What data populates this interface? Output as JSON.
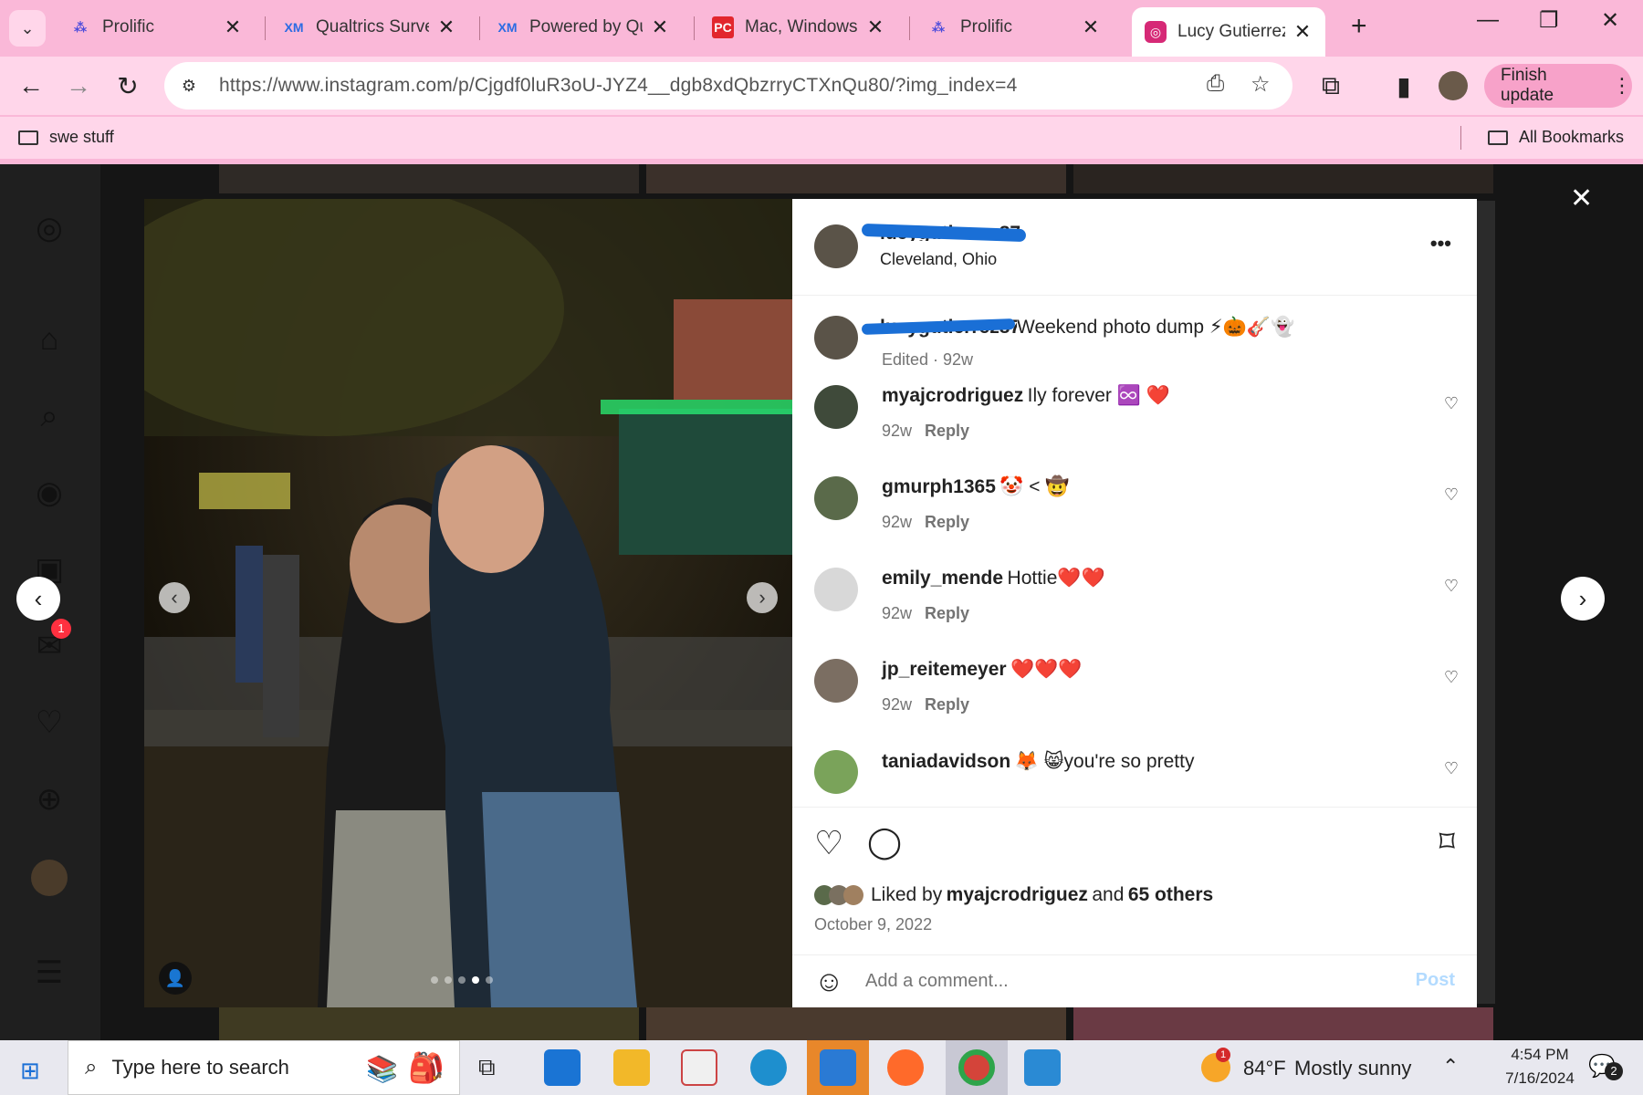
{
  "browser": {
    "tabs": [
      {
        "title": "Prolific",
        "icon": "prolific-icon",
        "color": "#4a4adb"
      },
      {
        "title": "Qualtrics Survey",
        "icon": "xm-icon",
        "color": "#2b6be3"
      },
      {
        "title": "Powered by Qua",
        "icon": "xm-icon",
        "color": "#2b6be3"
      },
      {
        "title": "Mac, Windows, C",
        "icon": "pc-icon",
        "color": "#e2262d"
      },
      {
        "title": "Prolific",
        "icon": "prolific-icon",
        "color": "#4a4adb"
      },
      {
        "title": "Lucy Gutierrez (",
        "icon": "instagram-icon",
        "color": "#d62976",
        "active": true
      }
    ],
    "url": "https://www.instagram.com/p/Cjgdf0luR3oU-JYZ4__dgb8xdQbzrryCTXnQu80/?img_index=4",
    "finish_update": "Finish update",
    "bookmarks": {
      "left": "swe stuff",
      "right": "All Bookmarks"
    }
  },
  "post": {
    "username_redacted": "lucygutierrez87",
    "location": "Cleveland, Ohio",
    "caption_user_redacted": "lucygutierrez87",
    "caption": "Weekend photo dump ⚡🎃🎸👻",
    "caption_meta": "Edited · 92w",
    "comments": [
      {
        "user": "myajcrodriguez",
        "text": "Ily forever ♾️ ❤️",
        "age": "92w",
        "reply": "Reply",
        "avatar_color": "#3f4a3a"
      },
      {
        "user": "gmurph1365",
        "text": "🤡 < 🤠",
        "age": "92w",
        "reply": "Reply",
        "avatar_color": "#5a6a4a"
      },
      {
        "user": "emily_mende",
        "text": "Hottie❤️❤️",
        "age": "92w",
        "reply": "Reply",
        "avatar_color": "#d8d8d8"
      },
      {
        "user": "jp_reitemeyer",
        "text": "❤️❤️❤️",
        "age": "92w",
        "reply": "Reply",
        "avatar_color": "#7b6e62"
      },
      {
        "user": "taniadavidson",
        "text": "🦊 😸you're so pretty",
        "age": "",
        "reply": "",
        "avatar_color": "#7aa35a"
      }
    ],
    "liked_by_prefix": "Liked by",
    "liked_by_user": "myajcrodriguez",
    "liked_by_and": "and",
    "liked_by_others": "65 others",
    "date": "October 9, 2022",
    "comment_placeholder": "Add a comment...",
    "post_button": "Post",
    "carousel": {
      "count": 5,
      "current": 4
    }
  },
  "taskbar": {
    "search_placeholder": "Type here to search",
    "weather_temp": "84°F",
    "weather_text": "Mostly sunny",
    "time": "4:54 PM",
    "date": "7/16/2024",
    "notifications": "2",
    "weather_badge": "1"
  },
  "sidebar": {
    "messages_badge": "1"
  }
}
